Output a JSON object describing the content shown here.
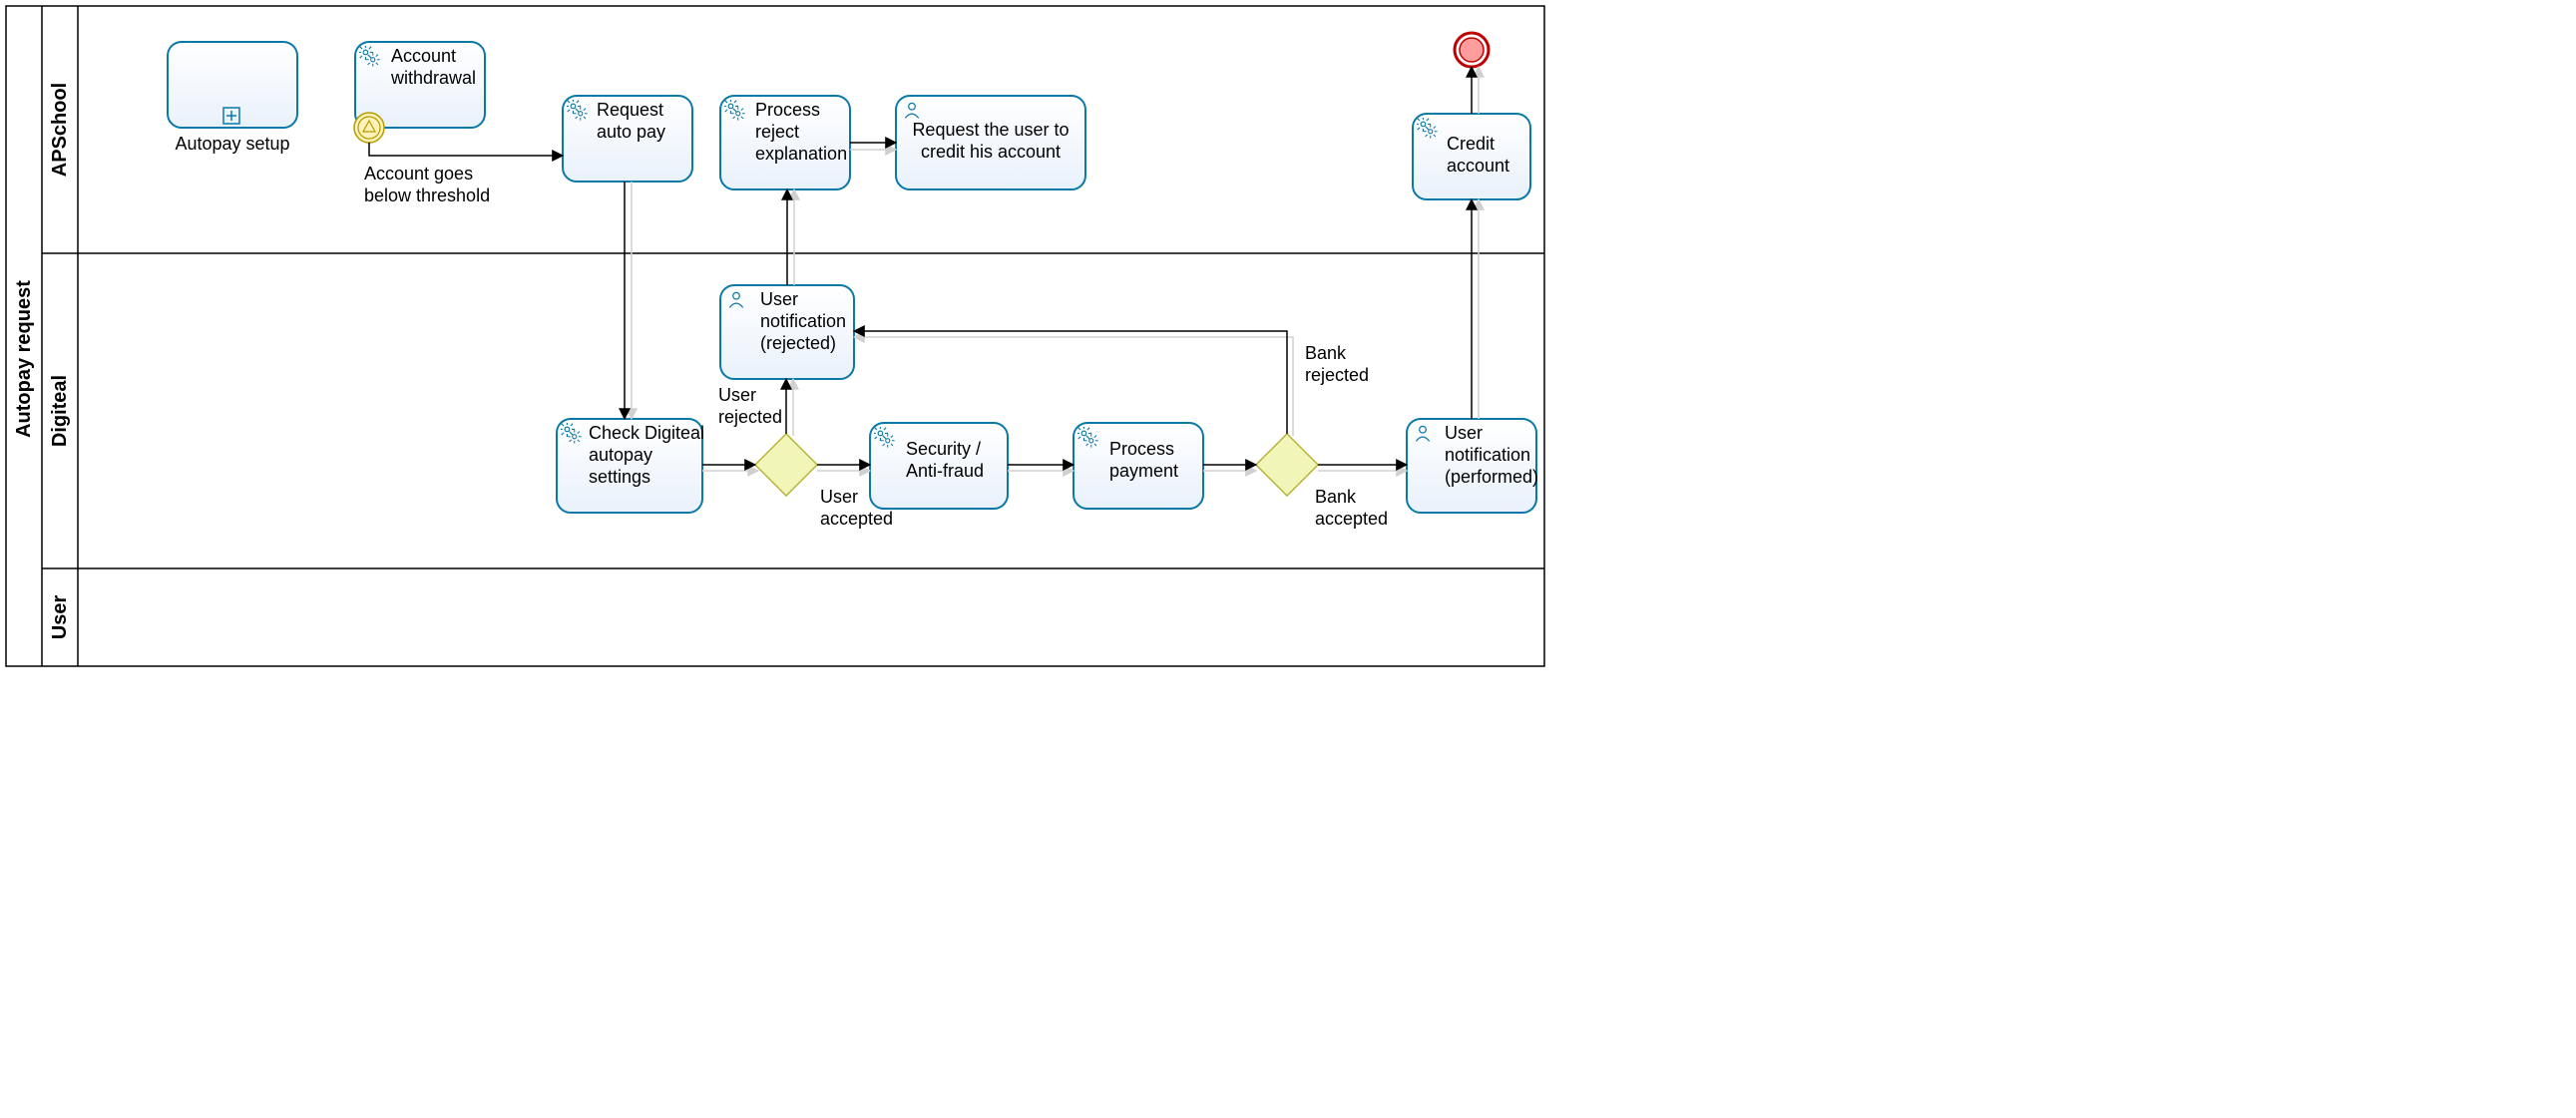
{
  "pool": {
    "title": "Autopay request"
  },
  "lanes": {
    "apschool": "APSchool",
    "digiteal": "Digiteal",
    "user": "User"
  },
  "tasks": {
    "autopay_setup": "Autopay setup",
    "account_withdrawal_l1": "Account",
    "account_withdrawal_l2": "withdrawal",
    "request_autopay_l1": "Request",
    "request_autopay_l2": "auto pay",
    "process_reject_l1": "Process",
    "process_reject_l2": "reject",
    "process_reject_l3": "explanation",
    "request_credit_l1": "Request the user to",
    "request_credit_l2": "credit his account",
    "credit_account_l1": "Credit",
    "credit_account_l2": "account",
    "check_settings_l1": "Check Digiteal",
    "check_settings_l2": "autopay",
    "check_settings_l3": "settings",
    "user_notif_rej_l1": "User",
    "user_notif_rej_l2": "notification",
    "user_notif_rej_l3": "(rejected)",
    "security_l1": "Security /",
    "security_l2": "Anti-fraud",
    "process_payment_l1": "Process",
    "process_payment_l2": "payment",
    "user_notif_perf_l1": "User",
    "user_notif_perf_l2": "notification",
    "user_notif_perf_l3": "(performed)"
  },
  "edges": {
    "below_threshold_l1": "Account goes",
    "below_threshold_l2": "below threshold",
    "user_rejected_l1": "User",
    "user_rejected_l2": "rejected",
    "user_accepted_l1": "User",
    "user_accepted_l2": "accepted",
    "bank_rejected_l1": "Bank",
    "bank_rejected_l2": "rejected",
    "bank_accepted_l1": "Bank",
    "bank_accepted_l2": "accepted"
  }
}
